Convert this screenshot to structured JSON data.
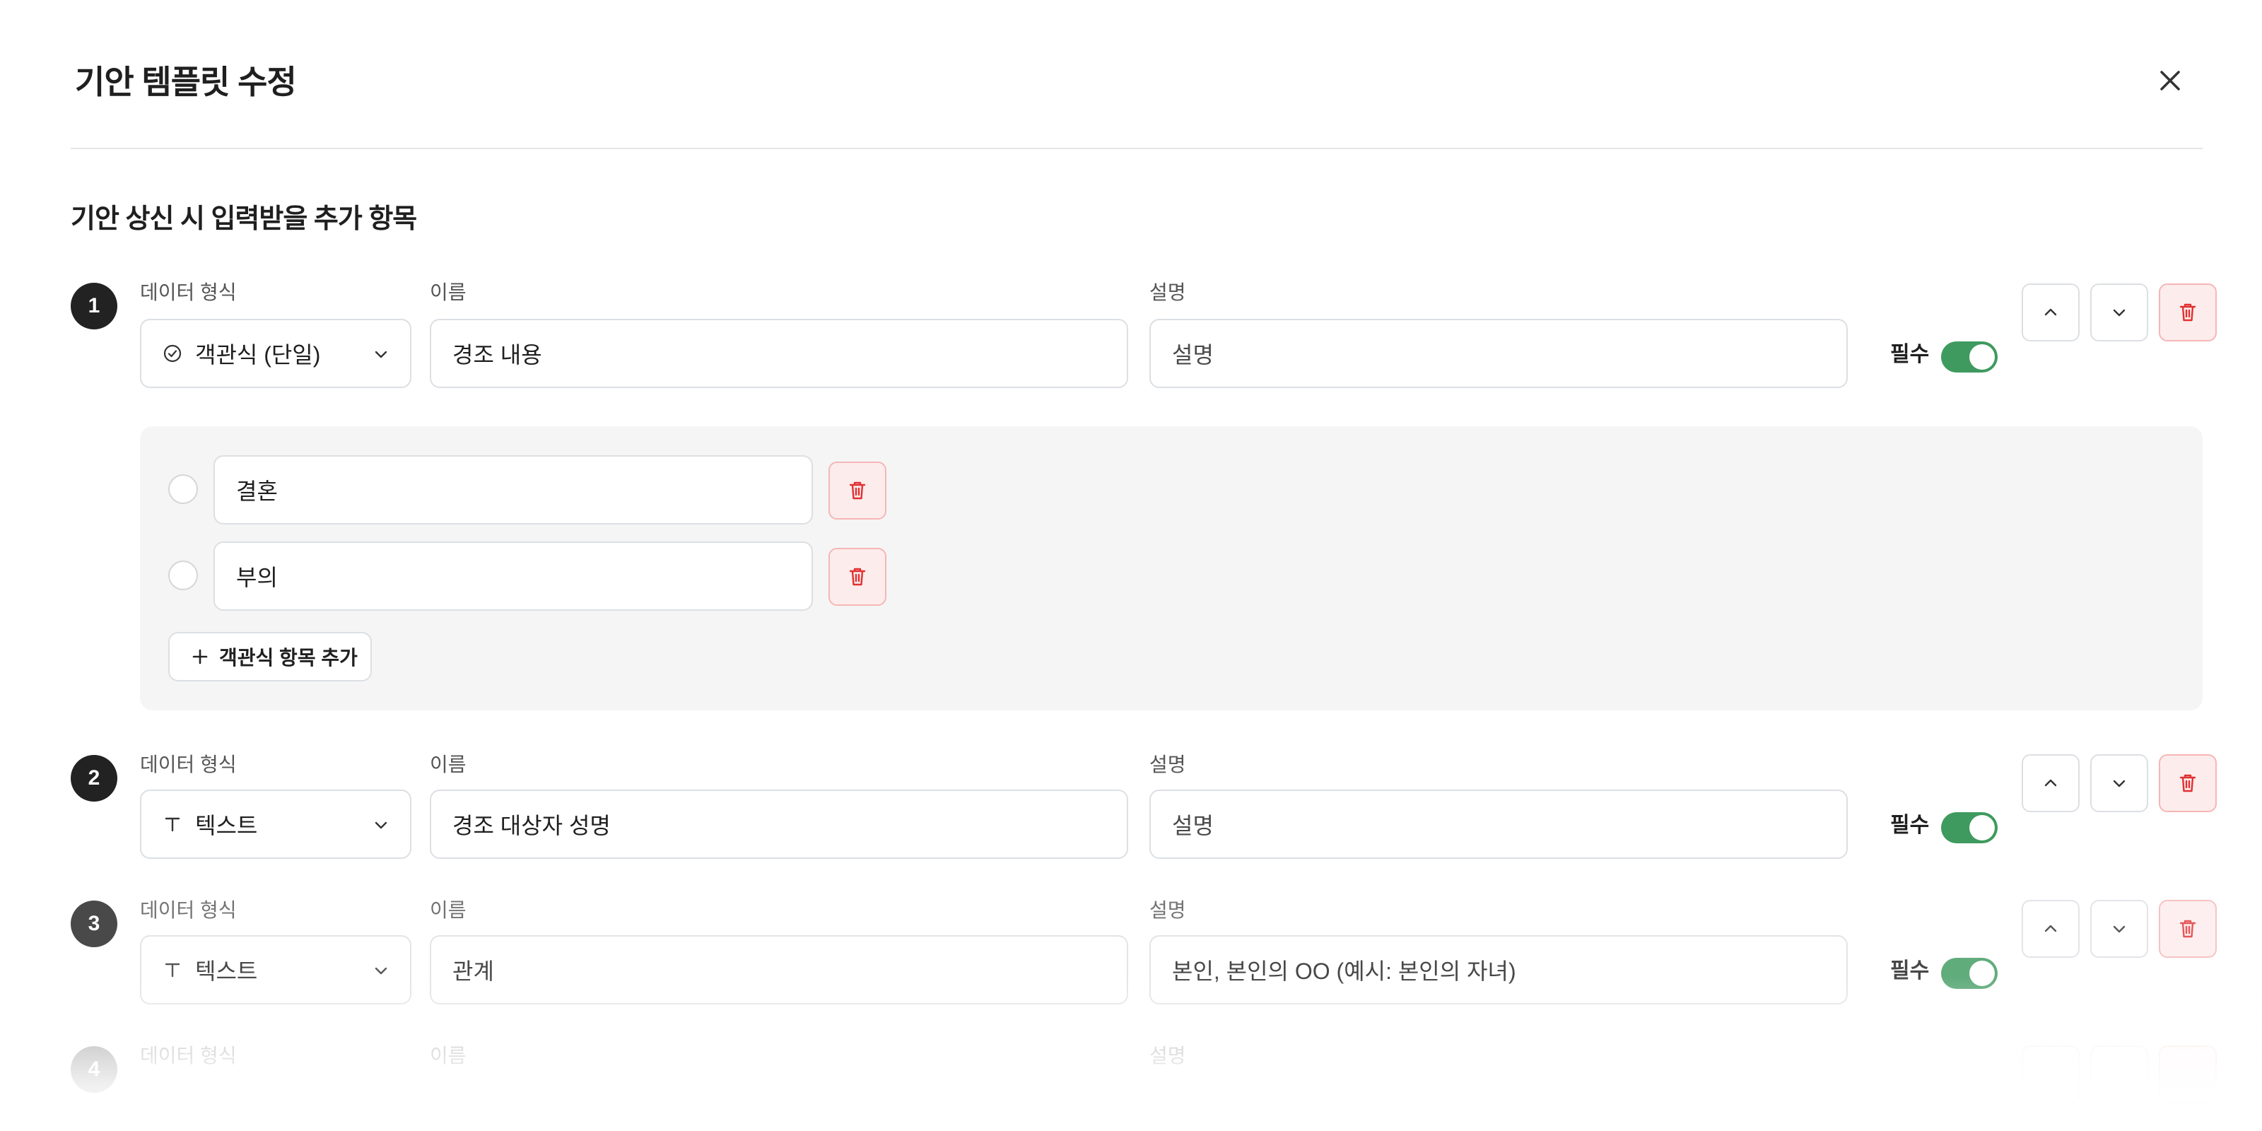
{
  "modal": {
    "title": "기안 템플릿 수정",
    "close_icon": "close-icon"
  },
  "section": {
    "title": "기안 상신 시 입력받을 추가 항목"
  },
  "common": {
    "type_label": "데이터 형식",
    "name_label": "이름",
    "desc_label": "설명",
    "required_label": "필수"
  },
  "fields": [
    {
      "number": "1",
      "type_value": "객관식 (단일)",
      "type_icon": "check-circle-icon",
      "name_value": "경조 내용",
      "desc_value": "설명",
      "required": true,
      "options": [
        {
          "value": "결혼"
        },
        {
          "value": "부의"
        }
      ],
      "add_option_label": "객관식 항목 추가"
    },
    {
      "number": "2",
      "type_value": "텍스트",
      "type_icon": "text-type-icon",
      "name_value": "경조 대상자 성명",
      "desc_value": "설명",
      "required": true
    },
    {
      "number": "3",
      "type_value": "텍스트",
      "type_icon": "text-type-icon",
      "name_value": "관계",
      "desc_value": "본인, 본인의 OO (예시: 본인의 자녀)",
      "required": true
    },
    {
      "number": "4"
    }
  ],
  "colors": {
    "toggle_on": "#3e9a5e",
    "delete_bg": "#fdecec",
    "delete_icon": "#e03131",
    "badge": "#222222"
  }
}
